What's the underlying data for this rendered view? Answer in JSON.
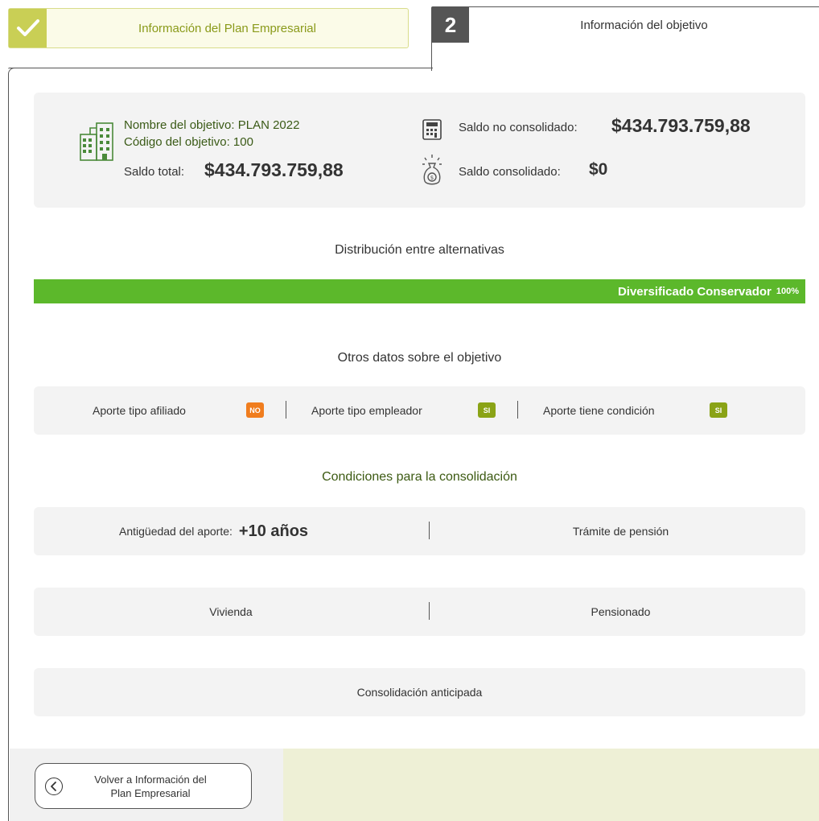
{
  "steps": {
    "step1": {
      "label": "Información del Plan Empresarial",
      "state": "completed"
    },
    "step2": {
      "number": "2",
      "label": "Información del objetivo",
      "state": "active"
    }
  },
  "summary": {
    "name_label": "Nombre del objetivo: PLAN 2022",
    "code_label": "Código del objetivo: 100",
    "total_label": "Saldo total:",
    "total_value": "$434.793.759,88",
    "non_consolidated_label": "Saldo no consolidado:",
    "non_consolidated_value": "$434.793.759,88",
    "consolidated_label": "Saldo consolidado:",
    "consolidated_value": "$0",
    "icons": [
      "building-icon",
      "calculator-icon",
      "money-bag-icon"
    ]
  },
  "distribution": {
    "title": "Distribución entre alternativas",
    "alternative": "Diversificado Conservador",
    "percent_label": "100%",
    "percent": 100,
    "bar_color": "#5cb82b"
  },
  "other_data": {
    "title": "Otros datos sobre el objetivo",
    "items": [
      {
        "label": "Aporte tipo afiliado",
        "badge": "NO",
        "badge_color": "#f07d1e"
      },
      {
        "label": "Aporte tipo empleador",
        "badge": "SI",
        "badge_color": "#8aa316"
      },
      {
        "label": "Aporte tiene condición",
        "badge": "SI",
        "badge_color": "#8aa316"
      }
    ]
  },
  "conditions": {
    "title": "Condiciones para la consolidación",
    "seniority_label": "Antigüedad del aporte:",
    "seniority_value": "+10 años",
    "pension_procedure": "Trámite de pensión",
    "housing": "Vivienda",
    "pensioner": "Pensionado",
    "early_consolidation": "Consolidación anticipada"
  },
  "footer": {
    "back_button_line1": "Volver a Información del",
    "back_button_line2": "Plan Empresarial"
  }
}
